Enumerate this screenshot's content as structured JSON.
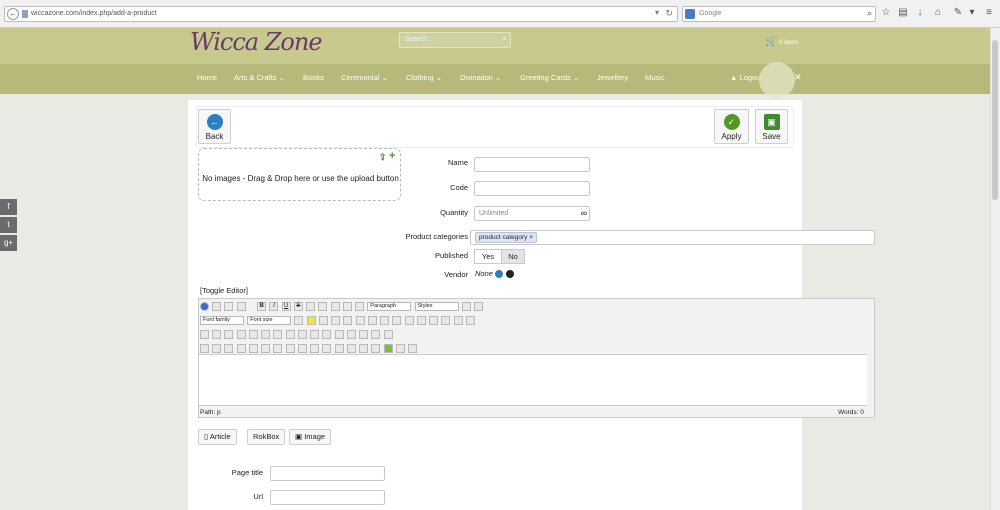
{
  "browser": {
    "url": "wiccazone.com/index.php/add-a-product",
    "search_placeholder": "Google"
  },
  "site": {
    "logo": "Wicca Zone",
    "search_placeholder": "Search...",
    "cart": "0 items"
  },
  "nav": {
    "home": "Home",
    "arts": "Arts & Crafts",
    "books": "Books",
    "ceremonial": "Ceremonial",
    "clothing": "Clothing",
    "divination": "Divination",
    "greeting": "Greeting Cards",
    "jewellery": "Jewellery",
    "music": "Music",
    "logout": "Logout"
  },
  "toolbar": {
    "back": "Back",
    "apply": "Apply",
    "save": "Save"
  },
  "dropzone": {
    "text": "No images - Drag & Drop here or use the upload button"
  },
  "form": {
    "name_label": "Name",
    "code_label": "Code",
    "quantity_label": "Quantity",
    "quantity_placeholder": "Unlimited",
    "infinity": "∞",
    "categories_label": "Product categories",
    "category_tag": "product category ×",
    "published_label": "Published",
    "yes": "Yes",
    "no": "No",
    "vendor_label": "Vendor",
    "vendor_value": "None",
    "page_title_label": "Page title",
    "url_label": "Url"
  },
  "editor": {
    "toggle": "[Toggle Editor]",
    "paragraph": "Paragraph",
    "styles": "Styles",
    "font_family": "Font family",
    "font_size": "Font size",
    "path": "Path: p",
    "words": "Words: 0"
  },
  "extra_buttons": {
    "article": "Article",
    "rokbox": "RokBox",
    "image": "Image"
  },
  "colors": {
    "header": "#c7c98d",
    "nav": "#b6b979",
    "logo": "#6a3a6a",
    "apply_green": "#4e9a23",
    "save_green": "#3f8a2d",
    "back_blue": "#2a7fc2"
  }
}
